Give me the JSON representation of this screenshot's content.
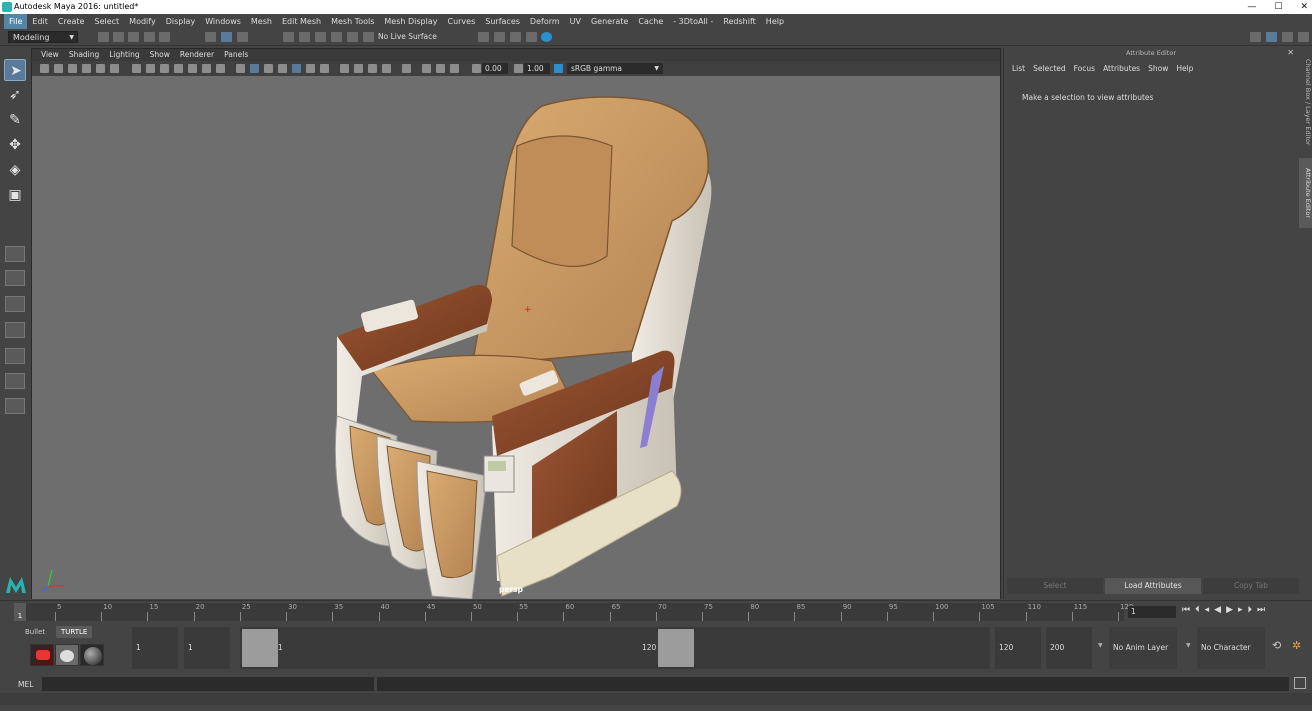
{
  "window": {
    "title": "Autodesk Maya 2016: untitled*",
    "controls": [
      "—",
      "☐",
      "✕"
    ]
  },
  "menubar": {
    "items": [
      "File",
      "Edit",
      "Create",
      "Select",
      "Modify",
      "Display",
      "Windows",
      "Mesh",
      "Edit Mesh",
      "Mesh Tools",
      "Mesh Display",
      "Curves",
      "Surfaces",
      "Deform",
      "UV",
      "Generate",
      "Cache",
      "- 3DtoAll -",
      "Redshift",
      "Help"
    ],
    "active": "File"
  },
  "statusline": {
    "mode": "Modeling",
    "live_surface": "No Live Surface"
  },
  "viewport": {
    "panel_menu": [
      "View",
      "Shading",
      "Lighting",
      "Show",
      "Renderer",
      "Panels"
    ],
    "exposure": "0.00",
    "gamma": "1.00",
    "color_space": "sRGB gamma",
    "camera": "persp"
  },
  "attribute_editor": {
    "title": "Attribute Editor",
    "menu": [
      "List",
      "Selected",
      "Focus",
      "Attributes",
      "Show",
      "Help"
    ],
    "message": "Make a selection to view attributes",
    "buttons": [
      "Select",
      "Load Attributes",
      "Copy Tab"
    ],
    "side_tabs": [
      "Channel Box / Layer Editor",
      "Attribute Editor"
    ]
  },
  "timeline": {
    "ticks": [
      "1",
      "5",
      "10",
      "15",
      "20",
      "25",
      "30",
      "35",
      "40",
      "45",
      "50",
      "55",
      "60",
      "65",
      "70",
      "75",
      "80",
      "85",
      "90",
      "95",
      "100",
      "105",
      "110",
      "115",
      "120"
    ],
    "current_frame": "1",
    "frame_field": "1"
  },
  "range": {
    "shelf_tabs": [
      "Bullet",
      "TURTLE"
    ],
    "start": "1",
    "playback_start": "1",
    "handle_start": "1",
    "handle_end": "120",
    "playback_end": "120",
    "end": "200",
    "anim_layer": "No Anim Layer",
    "char_set": "No Character Set"
  },
  "mel": {
    "label": "MEL"
  },
  "colors": {
    "accent": "#5285a6",
    "viewport_bg": "#6e6e6e",
    "leather": "#c99a63",
    "wood": "#8a4a28",
    "plastic": "#e2dcd2"
  }
}
